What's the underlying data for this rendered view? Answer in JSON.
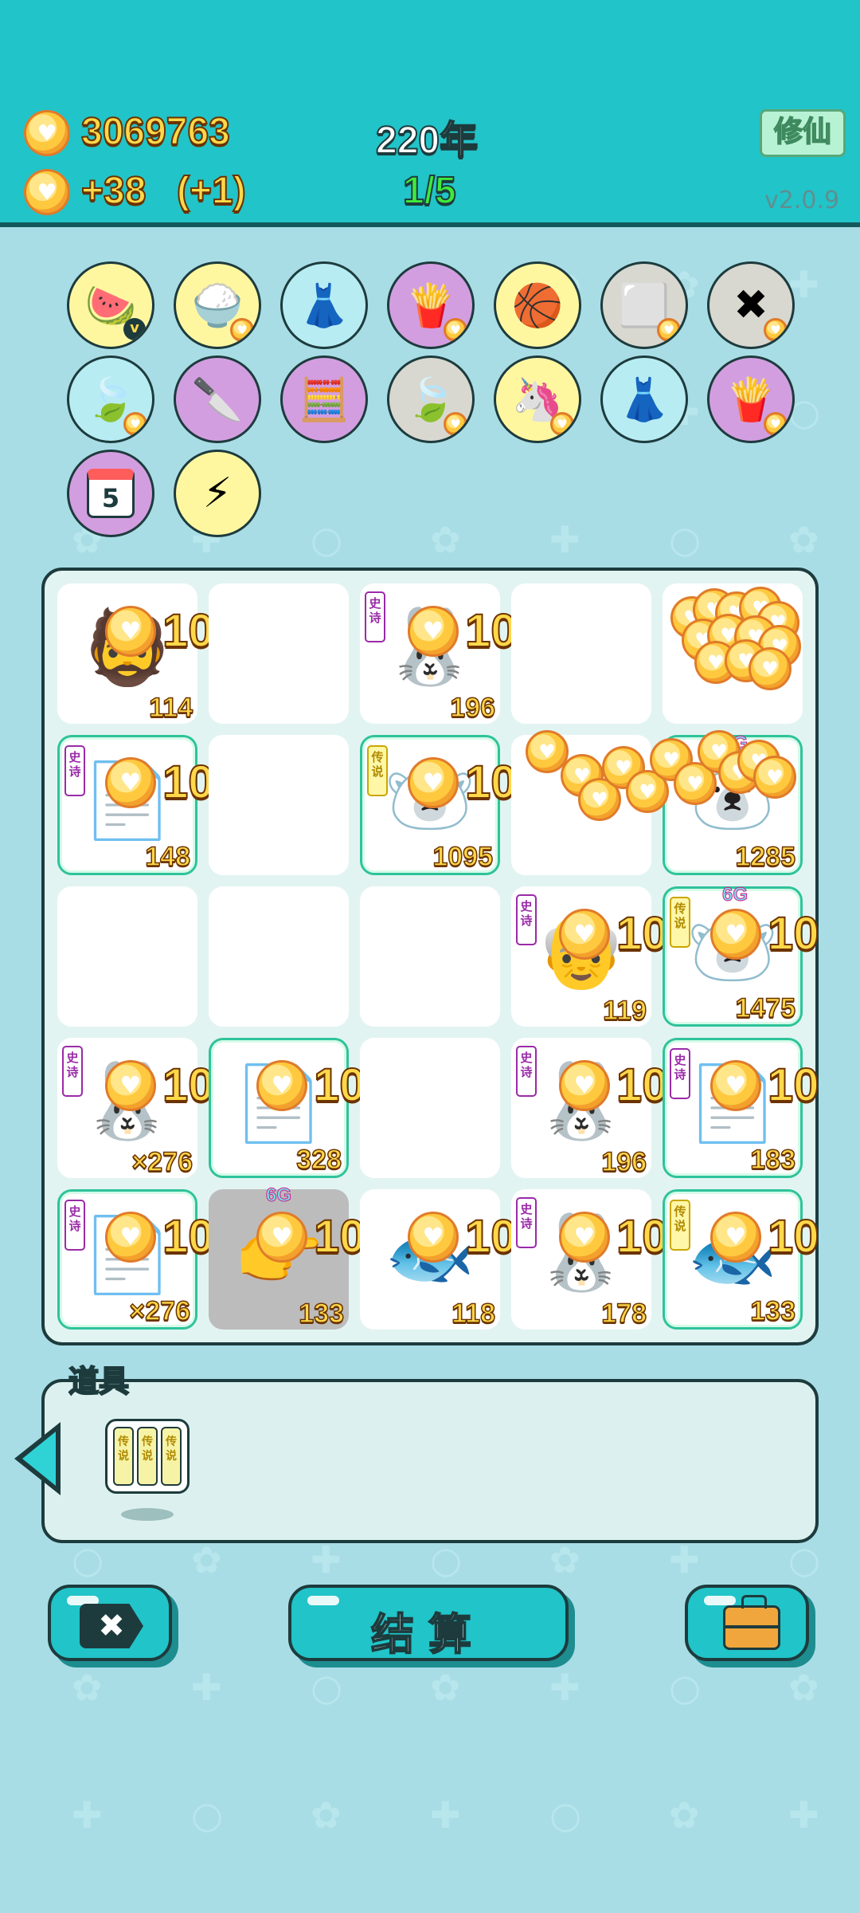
{
  "header": {
    "coins": "3069763",
    "income": "+38",
    "income_bonus": "(+1)",
    "year": "220年",
    "stage": "1/5",
    "cultivate_button": "修仙",
    "version": "v2.0.9",
    "colors": {
      "header_bg": "#21c4c8",
      "page_bg": "#a9dde6",
      "accent_border": "#1d3b3d"
    }
  },
  "skills": [
    {
      "name": "fruit-platter-icon",
      "glyph": "🍉",
      "bg": "#fff7a0",
      "badge": "v"
    },
    {
      "name": "rice-bowl-icon",
      "glyph": "🍚",
      "bg": "#fff7a0",
      "coin": true
    },
    {
      "name": "skirt-icon",
      "glyph": "👗",
      "bg": "#b7ecf3"
    },
    {
      "name": "fries-icon",
      "glyph": "🍟",
      "bg": "#d39ee0",
      "coin": true
    },
    {
      "name": "basketballs-icon",
      "glyph": "🏀",
      "bg": "#fff7a0"
    },
    {
      "name": "sugar-cubes-icon",
      "glyph": "⬜",
      "bg": "#d8d8d0",
      "coin": true
    },
    {
      "name": "delete-tag-icon",
      "glyph": "✖",
      "bg": "#d8d8d0",
      "coin": true
    },
    {
      "name": "leaf-icon",
      "glyph": "🍃",
      "bg": "#b7ecf3",
      "coin": true
    },
    {
      "name": "cleaver-icon",
      "glyph": "🔪",
      "bg": "#d39ee0"
    },
    {
      "name": "math-student-icon",
      "glyph": "🧮",
      "bg": "#d39ee0"
    },
    {
      "name": "leaf-icon",
      "glyph": "🍃",
      "bg": "#d8d8d0",
      "coin": true
    },
    {
      "name": "unicorn-icon",
      "glyph": "🦄",
      "bg": "#fff7a0",
      "coin": true
    },
    {
      "name": "skirt-icon",
      "glyph": "👗",
      "bg": "#b7ecf3"
    },
    {
      "name": "fries-icon",
      "glyph": "🍟",
      "bg": "#d39ee0",
      "coin": true
    },
    {
      "name": "calendar-icon",
      "glyph": "5",
      "bg": "#d39ee0"
    },
    {
      "name": "lightning-icon",
      "glyph": "⚡",
      "bg": "#fff7a0"
    }
  ],
  "board": {
    "cells": [
      {
        "item": "bald-man",
        "glyph": "🧔",
        "value": "114",
        "reward": "10"
      },
      {
        "item": "empty"
      },
      {
        "item": "rabbit-shrine",
        "glyph": "🐰",
        "value": "196",
        "reward": "10",
        "tag": "史诗",
        "tagType": "purple"
      },
      {
        "item": "empty"
      },
      {
        "item": "coin-pile"
      },
      {
        "item": "copy-paste-card",
        "glyph": "📄",
        "value": "148",
        "reward": "10",
        "tag": "史诗",
        "tagType": "purple",
        "rare": true
      },
      {
        "item": "empty"
      },
      {
        "item": "white-bear",
        "glyph": "🐻‍❄️",
        "value": "1095",
        "reward": "10",
        "tag": "传说",
        "tagType": "yellow",
        "rare": true
      },
      {
        "item": "empty"
      },
      {
        "item": "white-bear-6g",
        "glyph": "🐻‍❄️",
        "value": "1285",
        "rare": true,
        "gtag": "6G"
      },
      {
        "item": "empty"
      },
      {
        "item": "empty"
      },
      {
        "item": "empty"
      },
      {
        "item": "grumpy-old-man",
        "glyph": "👴",
        "value": "119",
        "reward": "10",
        "tag": "史诗",
        "tagType": "purple"
      },
      {
        "item": "white-bear-6g",
        "glyph": "🐻‍❄️",
        "value": "1475",
        "reward": "10",
        "tag": "传说",
        "tagType": "yellow",
        "rare": true,
        "gtag": "6G"
      },
      {
        "item": "rabbit-shrine-gold",
        "glyph": "🐰",
        "value": "×276",
        "reward": "10",
        "tag": "史诗",
        "tagType": "purple"
      },
      {
        "item": "copy-paste-card",
        "glyph": "📄",
        "value": "328",
        "reward": "10",
        "rare": true
      },
      {
        "item": "empty"
      },
      {
        "item": "rabbit-shrine",
        "glyph": "🐰",
        "value": "196",
        "reward": "10",
        "tag": "史诗",
        "tagType": "purple"
      },
      {
        "item": "copy-paste-card",
        "glyph": "📄",
        "value": "183",
        "reward": "10",
        "tag": "史诗",
        "tagType": "purple",
        "rare": true
      },
      {
        "item": "copy-paste-card-gold",
        "glyph": "📄",
        "value": "×276",
        "reward": "10",
        "tag": "史诗",
        "tagType": "purple",
        "rare": true
      },
      {
        "item": "pointing-hand",
        "glyph": "👉",
        "value": "133",
        "reward": "10",
        "grey": true,
        "gtag": "6G"
      },
      {
        "item": "koi-fish",
        "glyph": "🐟",
        "value": "118",
        "reward": "10"
      },
      {
        "item": "rabbit-shrine",
        "glyph": "🐰",
        "value": "178",
        "reward": "10",
        "tag": "史诗",
        "tagType": "purple"
      },
      {
        "item": "koi-fish",
        "glyph": "🐟",
        "value": "133",
        "reward": "10",
        "tag": "传说",
        "tagType": "yellow",
        "rare": true
      }
    ]
  },
  "props": {
    "title": "道具",
    "item_label": "传说"
  },
  "buttons": {
    "settle": "结算"
  }
}
